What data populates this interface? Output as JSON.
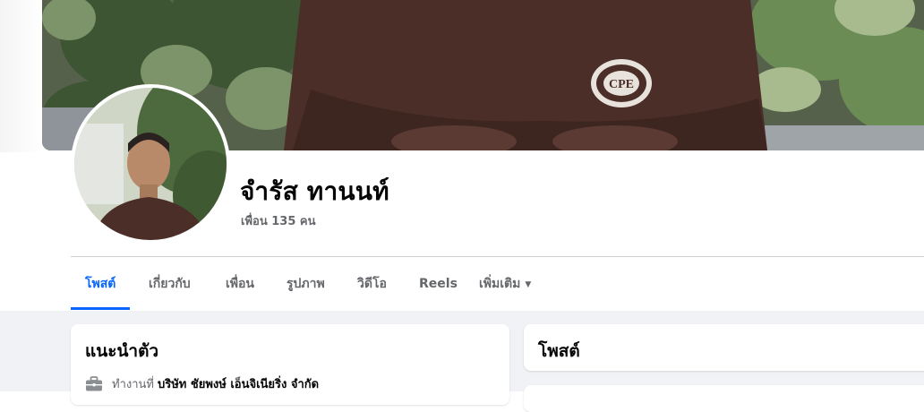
{
  "profile": {
    "name": "จำรัส ทานนท์",
    "friends": "เพื่อน 135 คน",
    "cover_logo": "CPE"
  },
  "tabs": [
    {
      "label": "โพสต์",
      "active": true
    },
    {
      "label": "เกี่ยวกับ",
      "active": false
    },
    {
      "label": "เพื่อน",
      "active": false
    },
    {
      "label": "รูปภาพ",
      "active": false
    },
    {
      "label": "วิดีโอ",
      "active": false
    },
    {
      "label": "Reels",
      "active": false
    },
    {
      "label": "เพิ่มเติม",
      "active": false,
      "icon": "caret-down-icon"
    }
  ],
  "intro": {
    "title": "แนะนำตัว",
    "work_prefix": "ทำงานที่",
    "work_company": "บริษัท ชัยพงษ์ เอ็นจิเนียริ่ง จำกัด",
    "work_icon": "briefcase-icon"
  },
  "posts": {
    "title": "โพสต์"
  },
  "colors": {
    "accent": "#0866ff",
    "secondary_text": "#65676b",
    "feed_background": "#f0f2f5",
    "cover_shirt": "#4a2e27"
  }
}
